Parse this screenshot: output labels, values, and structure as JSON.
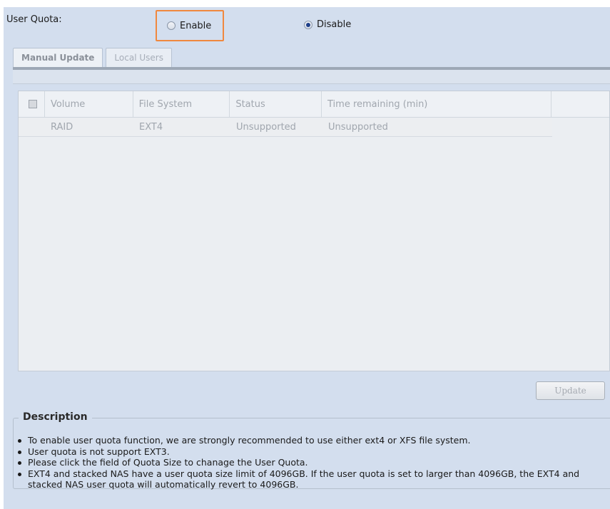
{
  "quota": {
    "label": "User Quota:",
    "enable_label": "Enable",
    "disable_label": "Disable",
    "selected": "Disable"
  },
  "tabs": [
    {
      "label": "Manual Update",
      "active": true
    },
    {
      "label": "Local Users",
      "active": false
    }
  ],
  "grid": {
    "columns": [
      "Volume",
      "File System",
      "Status",
      "Time remaining (min)"
    ],
    "rows": [
      {
        "volume": "RAID",
        "file_system": "EXT4",
        "status": "Unsupported",
        "time_remaining": "Unsupported"
      }
    ]
  },
  "update_label": "Update",
  "description": {
    "title": "Description",
    "items": [
      "To enable user quota function, we are strongly recommended to use either ext4 or XFS file system.",
      "User quota is not support EXT3.",
      "Please click the field of Quota Size to chanage the User Quota.",
      "EXT4 and stacked NAS have a user quota size limit of 4096GB. If the user quota is set to larger than 4096GB, the EXT4 and stacked NAS user quota will automatically revert to 4096GB."
    ]
  },
  "colors": {
    "panel_bg": "#d3deee",
    "highlight_border": "#f0883e",
    "radio_selected": "#1d3f8a"
  }
}
